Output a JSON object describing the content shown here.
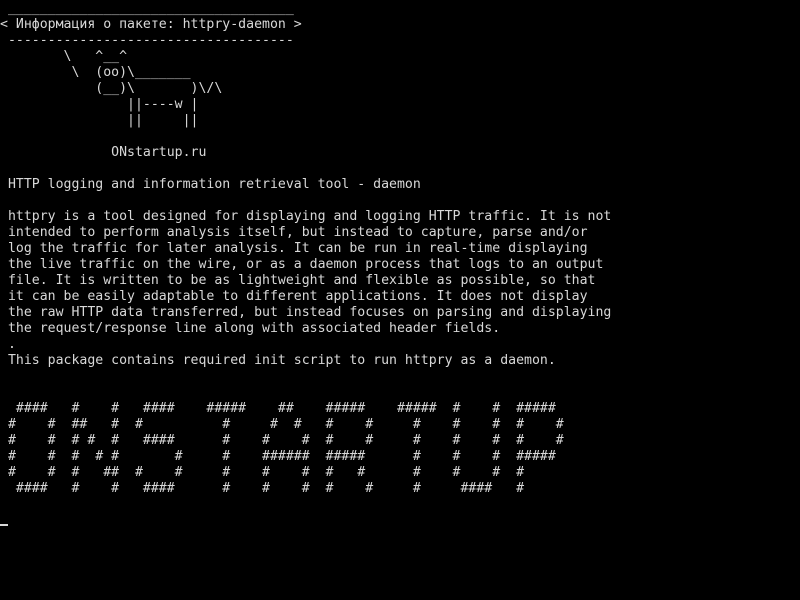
{
  "terminal": {
    "foreground_color": "#d8d8d8",
    "background_color": "#000000",
    "cowsay_top_border": " ____________________________________",
    "cowsay_message": "< Информация о пакете: httpry-daemon >",
    "cowsay_bottom_border": " ------------------------------------",
    "cow_art": [
      "        \\   ^__^",
      "         \\  (oo)\\_______",
      "            (__)\\       )\\/\\",
      "                ||----w |",
      "                ||     ||"
    ],
    "site_label": "              ONstartup.ru",
    "package_summary": " HTTP logging and information retrieval tool - daemon",
    "description": [
      " httpry is a tool designed for displaying and logging HTTP traffic. It is not",
      " intended to perform analysis itself, but instead to capture, parse and/or",
      " log the traffic for later analysis. It can be run in real-time displaying",
      " the live traffic on the wire, or as a daemon process that logs to an output",
      " file. It is written to be as lightweight and flexible as possible, so that",
      " it can be easily adaptable to different applications. It does not display",
      " the raw HTTP data transferred, but instead focuses on parsing and displaying",
      " the request/response line along with associated header fields.",
      " .",
      " This package contains required init script to run httpry as a daemon."
    ],
    "banner": [
      "  ####   #    #   ####    #####    ##    #####    #####  #    #  #####",
      " #    #  ##   #  #          #     #  #   #    #     #    #    #  #    #",
      " #    #  # #  #   ####      #    #    #  #    #     #    #    #  #    #",
      " #    #  #  # #       #     #    ######  #####      #    #    #  #####",
      " #    #  #   ##  #    #     #    #    #  #   #      #    #    #  #",
      "  ####   #    #   ####      #    #    #  #    #     #     ####   #"
    ]
  }
}
